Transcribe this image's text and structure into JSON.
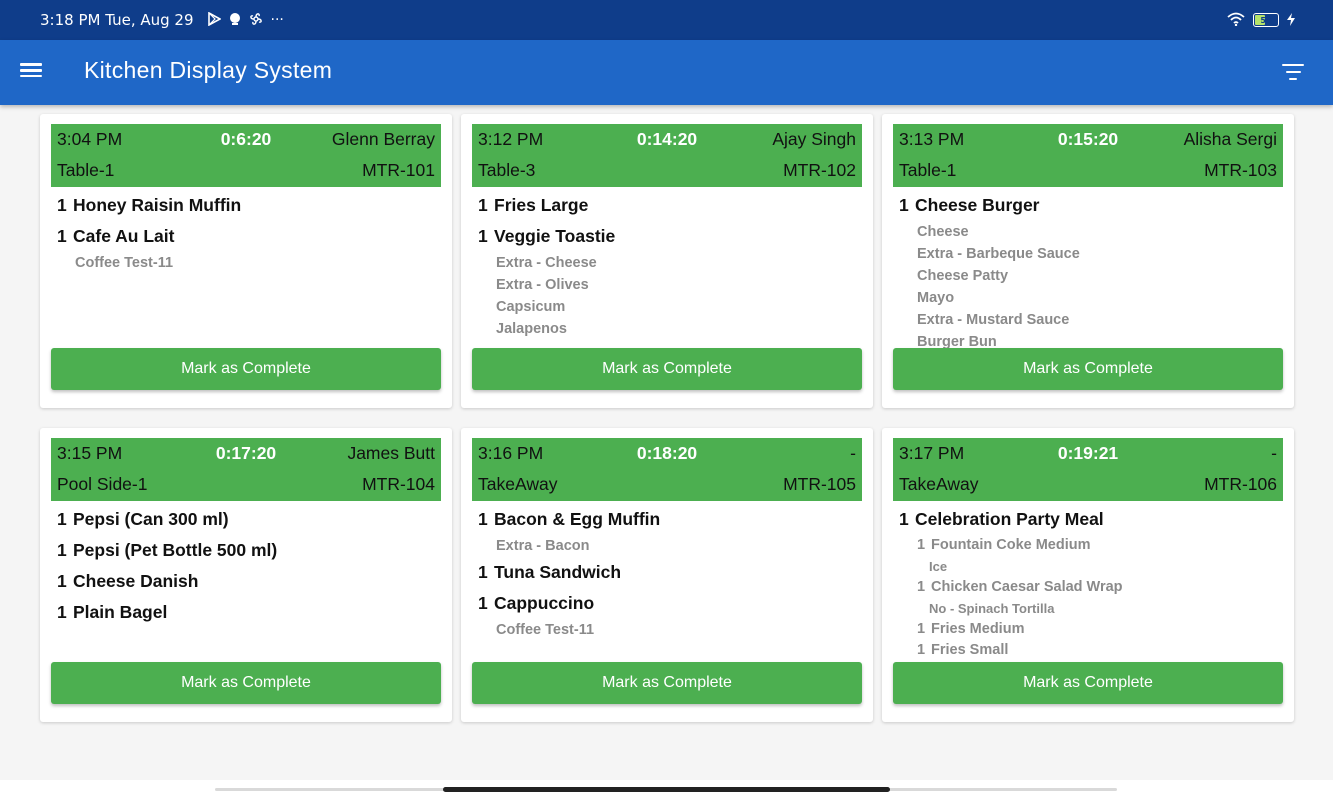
{
  "status_bar": {
    "time": "3:18 PM Tue, Aug 29",
    "icons": [
      "play-store-icon",
      "notification-icon",
      "fan-icon",
      "more-dots-icon"
    ],
    "more": "···",
    "battery_level": "50"
  },
  "app_bar": {
    "title": "Kitchen Display System",
    "menu_icon": "hamburger-menu-icon",
    "filter_icon": "filter-icon"
  },
  "colors": {
    "status_bar": "#0f3d8a",
    "app_bar": "#1f67c7",
    "accent_green": "#4caf50",
    "modifier_gray": "#8a8a8a"
  },
  "orders": [
    {
      "time": "3:04 PM",
      "elapsed": "0:6:20",
      "customer": "Glenn Berray",
      "table": "Table-1",
      "order_no": "MTR-101",
      "button": "Mark as Complete",
      "items": [
        {
          "qty": "1",
          "name": "Honey Raisin Muffin",
          "mods": []
        },
        {
          "qty": "1",
          "name": "Cafe Au Lait",
          "mods": [
            "Coffee Test-11"
          ]
        }
      ]
    },
    {
      "time": "3:12 PM",
      "elapsed": "0:14:20",
      "customer": "Ajay Singh",
      "table": "Table-3",
      "order_no": "MTR-102",
      "button": "Mark as Complete",
      "items": [
        {
          "qty": "1",
          "name": "Fries Large",
          "mods": []
        },
        {
          "qty": "1",
          "name": "Veggie Toastie",
          "mods": [
            "Extra - Cheese",
            "Extra - Olives",
            "Capsicum",
            "Jalapenos"
          ]
        }
      ]
    },
    {
      "time": "3:13 PM",
      "elapsed": "0:15:20",
      "customer": "Alisha Sergi",
      "table": "Table-1",
      "order_no": "MTR-103",
      "button": "Mark as Complete",
      "items": [
        {
          "qty": "1",
          "name": "Cheese Burger",
          "mods": [
            "Cheese",
            "Extra - Barbeque Sauce",
            "Cheese Patty",
            "Mayo",
            "Extra - Mustard Sauce",
            "Burger Bun"
          ]
        }
      ]
    },
    {
      "time": "3:15 PM",
      "elapsed": "0:17:20",
      "customer": "James Butt",
      "table": "Pool Side-1",
      "order_no": "MTR-104",
      "button": "Mark as Complete",
      "items": [
        {
          "qty": "1",
          "name": "Pepsi (Can 300 ml)",
          "mods": []
        },
        {
          "qty": "1",
          "name": "Pepsi (Pet Bottle 500 ml)",
          "mods": []
        },
        {
          "qty": "1",
          "name": "Cheese Danish",
          "mods": []
        },
        {
          "qty": "1",
          "name": "Plain Bagel",
          "mods": []
        }
      ]
    },
    {
      "time": "3:16 PM",
      "elapsed": "0:18:20",
      "customer": "-",
      "table": "TakeAway",
      "order_no": "MTR-105",
      "button": "Mark as Complete",
      "items": [
        {
          "qty": "1",
          "name": "Bacon & Egg Muffin",
          "mods": [
            "Extra - Bacon"
          ]
        },
        {
          "qty": "1",
          "name": "Tuna Sandwich",
          "mods": []
        },
        {
          "qty": "1",
          "name": "Cappuccino",
          "mods": [
            "Coffee Test-11"
          ]
        }
      ]
    },
    {
      "time": "3:17 PM",
      "elapsed": "0:19:21",
      "customer": "-",
      "table": "TakeAway",
      "order_no": "MTR-106",
      "button": "Mark as Complete",
      "items": [
        {
          "qty": "1",
          "name": "Celebration Party Meal",
          "mods": [],
          "sub_items": [
            {
              "qty": "1",
              "name": "Fountain Coke Medium",
              "mods": [
                "Ice"
              ]
            },
            {
              "qty": "1",
              "name": "Chicken Caesar Salad Wrap",
              "mods": [
                "No - Spinach Tortilla"
              ]
            },
            {
              "qty": "1",
              "name": "Fries Medium",
              "mods": []
            },
            {
              "qty": "1",
              "name": "Fries Small",
              "mods": []
            }
          ]
        }
      ]
    }
  ]
}
